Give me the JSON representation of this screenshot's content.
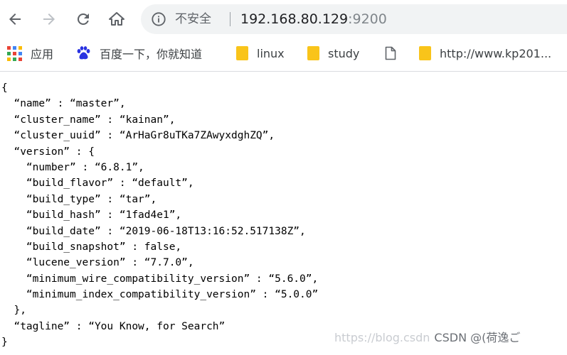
{
  "toolbar": {
    "back_icon": "arrow-left-icon",
    "forward_icon": "arrow-right-icon",
    "reload_icon": "reload-icon",
    "home_icon": "home-icon",
    "security_icon": "info-circle-icon",
    "security_label": "不安全",
    "url_host": "192.168.80.129",
    "url_port": ":9200"
  },
  "bookmarks": {
    "items": [
      {
        "label": "应用",
        "icon": "apps-grid-icon"
      },
      {
        "label": "百度一下，你就知道",
        "icon": "baidu-paw-icon"
      },
      {
        "label": "linux",
        "icon": "folder-icon"
      },
      {
        "label": "study",
        "icon": "folder-icon"
      },
      {
        "label": "",
        "icon": "page-icon"
      },
      {
        "label": "http://www.kp201...",
        "icon": "folder-icon"
      }
    ]
  },
  "json_lines": [
    "{",
    "  “name” : “master”,",
    "  “cluster_name” : “kainan”,",
    "  “cluster_uuid” : “ArHaGr8uTKa7ZAwyxdghZQ”,",
    "  “version” : {",
    "    “number” : “6.8.1”,",
    "    “build_flavor” : “default”,",
    "    “build_type” : “tar”,",
    "    “build_hash” : “1fad4e1”,",
    "    “build_date” : “2019-06-18T13:16:52.517138Z”,",
    "    “build_snapshot” : false,",
    "    “lucene_version” : “7.7.0”,",
    "    “minimum_wire_compatibility_version” : “5.6.0”,",
    "    “minimum_index_compatibility_version” : “5.0.0”",
    "  },",
    "  “tagline” : “You Know, for Search”",
    "}"
  ],
  "watermark": {
    "url": "https://blog.csdn",
    "author": "CSDN @(荷逸ご"
  },
  "colors": {
    "omnibox_bg": "#f1f3f4",
    "folder": "#f9c41a",
    "icon": "#5f6368"
  }
}
